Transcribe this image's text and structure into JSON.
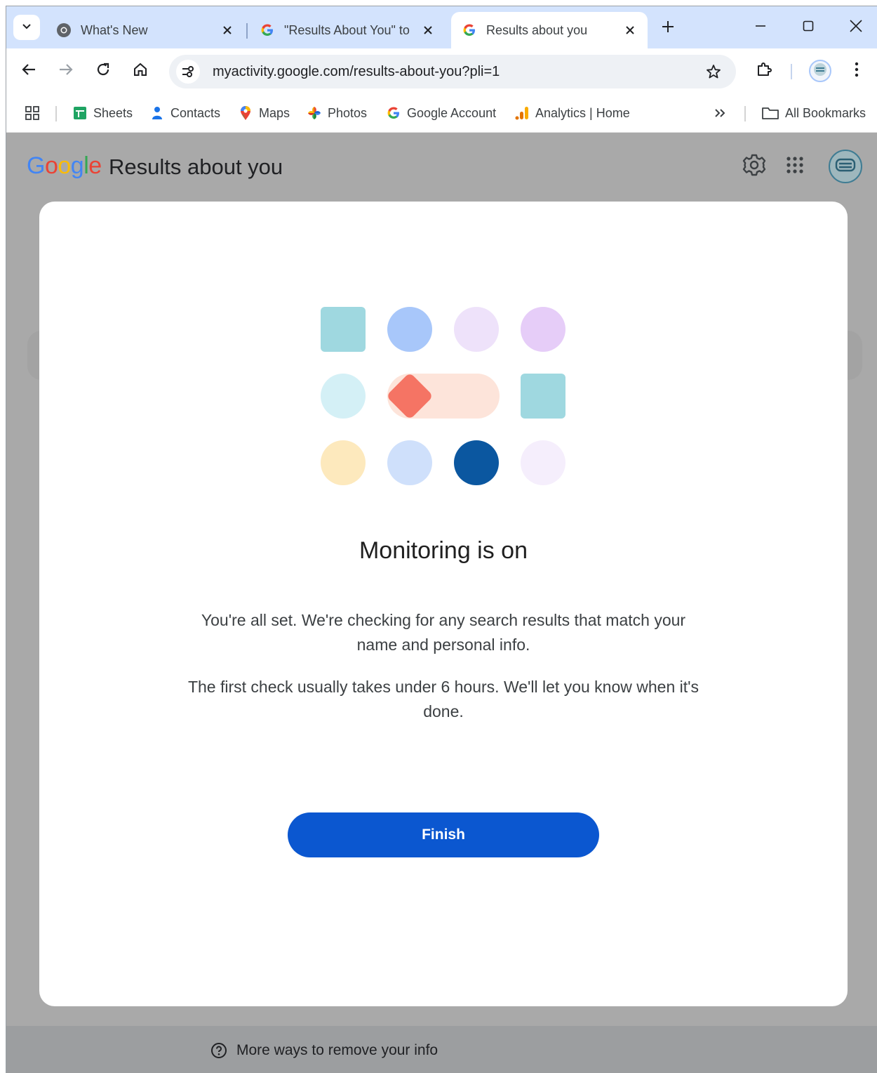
{
  "browser": {
    "tabs": [
      {
        "title": "What's New",
        "active": false
      },
      {
        "title": "\"Results About You\" to",
        "active": false
      },
      {
        "title": "Results about you",
        "active": true
      }
    ],
    "url": "myactivity.google.com/results-about-you?pli=1",
    "bookmarks": [
      {
        "label": "Sheets"
      },
      {
        "label": "Contacts"
      },
      {
        "label": "Maps"
      },
      {
        "label": "Photos"
      },
      {
        "label": "Google Account"
      },
      {
        "label": "Analytics | Home"
      }
    ],
    "all_bookmarks_label": "All Bookmarks"
  },
  "header": {
    "logo_letters": [
      "G",
      "o",
      "o",
      "g",
      "l",
      "e"
    ],
    "product_name": "Results about you"
  },
  "dialog": {
    "title": "Monitoring is on",
    "paragraph1": "You're all set. We're checking for any search results that match your name and personal info.",
    "paragraph2": "The first check usually takes under 6 hours. We'll let you know when it's done.",
    "finish_label": "Finish"
  },
  "footer": {
    "link_label": "More ways to remove your info"
  },
  "colors": {
    "accent": "#0b57d0",
    "tabstrip": "#d3e3fd",
    "scrim": "#a9a9a9"
  }
}
